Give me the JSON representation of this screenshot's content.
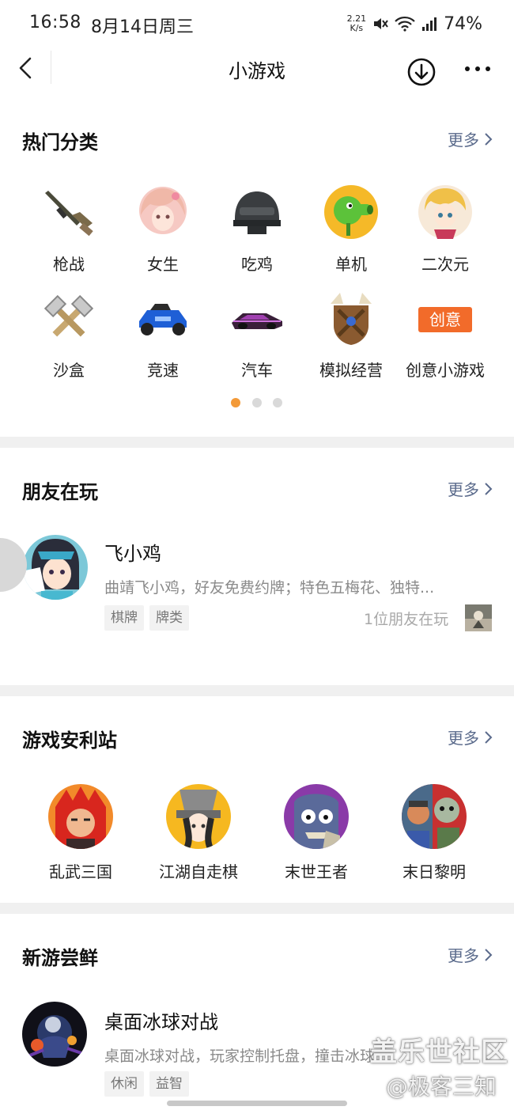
{
  "status_bar": {
    "time": "16:58",
    "date": "8月14日周三",
    "net_speed_value": "2.21",
    "net_speed_unit": "K/s",
    "battery": "74%"
  },
  "nav": {
    "title": "小游戏",
    "back_icon": "chevron-left-icon",
    "download_icon": "download-circle-icon",
    "more_icon": "more-dots-icon"
  },
  "hot_categories": {
    "title": "热门分类",
    "more": "更多",
    "items": [
      {
        "label": "枪战",
        "icon": "rifle-icon"
      },
      {
        "label": "女生",
        "icon": "anime-girl-icon"
      },
      {
        "label": "吃鸡",
        "icon": "helmet-icon"
      },
      {
        "label": "单机",
        "icon": "peashooter-icon"
      },
      {
        "label": "二次元",
        "icon": "anime-character-icon"
      },
      {
        "label": "沙盒",
        "icon": "crossed-hammers-icon"
      },
      {
        "label": "竞速",
        "icon": "kart-icon"
      },
      {
        "label": "汽车",
        "icon": "racing-car-icon"
      },
      {
        "label": "模拟经营",
        "icon": "shield-horns-icon"
      },
      {
        "label": "创意小游戏",
        "icon": "creative-badge-icon",
        "badge_text": "创意"
      }
    ],
    "pager": {
      "count": 3,
      "active": 0
    },
    "accent_color": "#f39a38"
  },
  "friends_playing": {
    "title": "朋友在玩",
    "more": "更多",
    "game": {
      "name": "飞小鸡",
      "description": "曲靖飞小鸡，好友免费约牌；特色五梅花、独特...",
      "tags": [
        "棋牌",
        "牌类"
      ],
      "friends_text": "1位朋友在玩"
    }
  },
  "welfare_station": {
    "title": "游戏安利站",
    "more": "更多",
    "items": [
      {
        "label": "乱武三国",
        "icon": "warrior-red-icon"
      },
      {
        "label": "江湖自走棋",
        "icon": "swordsman-icon"
      },
      {
        "label": "末世王者",
        "icon": "zombie-cartoon-icon"
      },
      {
        "label": "末日黎明",
        "icon": "zombie-crowd-icon"
      }
    ]
  },
  "new_games": {
    "title": "新游尝鲜",
    "more": "更多",
    "game": {
      "name": "桌面冰球对战",
      "description": "桌面冰球对战，玩家控制托盘，撞击冰球",
      "tags": [
        "休闲",
        "益智"
      ]
    }
  },
  "watermark": {
    "line1": "盖乐世社区",
    "line2": "@极客三知"
  }
}
